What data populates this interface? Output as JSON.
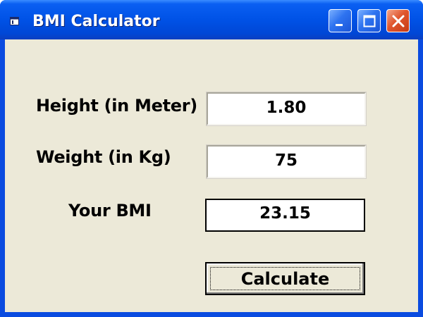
{
  "window": {
    "title": "BMI Calculator",
    "icon": "window-app-icon",
    "controls": {
      "minimize_icon": "minimize-icon",
      "maximize_icon": "maximize-icon",
      "close_icon": "close-icon"
    }
  },
  "form": {
    "height_label": "Height (in Meter)",
    "height_value": "1.80",
    "weight_label": "Weight (in Kg)",
    "weight_value": "75",
    "bmi_label": "Your BMI",
    "bmi_value": "23.15",
    "calculate_label": "Calculate"
  },
  "colors": {
    "titlebar": "#0052e6",
    "client_background": "#ece9d8",
    "close_button": "#e0572f"
  }
}
